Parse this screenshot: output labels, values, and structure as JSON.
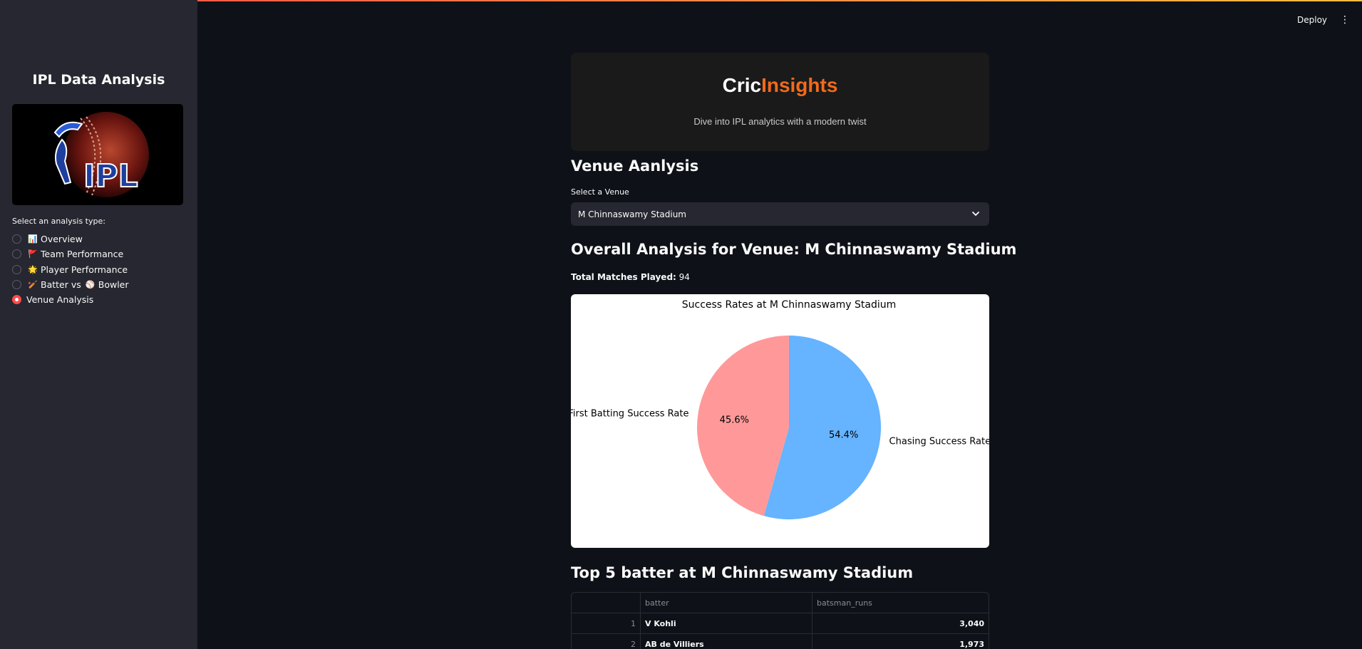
{
  "sidebar": {
    "title": "IPL Data Analysis",
    "logo_text": "IPL",
    "radio_label": "Select an analysis type:",
    "options": [
      {
        "icon": "📊",
        "label": "Overview",
        "selected": false
      },
      {
        "icon": "🚩",
        "label": "Team Performance",
        "selected": false
      },
      {
        "icon": "🌟",
        "label": "Player Performance",
        "selected": false
      },
      {
        "icon": "🏏",
        "label": "Batter vs",
        "icon2": "⚾",
        "label2": "Bowler",
        "selected": false
      },
      {
        "icon": "",
        "label": "Venue Analysis",
        "selected": true
      }
    ]
  },
  "header": {
    "deploy_label": "Deploy",
    "menu_icon": "⋮"
  },
  "hero": {
    "title_a": "Cric",
    "title_b": "Insights",
    "subtitle": "Dive into IPL analytics with a modern twist"
  },
  "venue": {
    "heading": "Venue Aanlysis",
    "select_label": "Select a Venue",
    "selected_venue": "M Chinnaswamy Stadium",
    "overall_heading": "Overall Analysis for Venue: M Chinnaswamy Stadium",
    "matches_label": "Total Matches Played:",
    "matches_value": "94"
  },
  "chart_data": {
    "type": "pie",
    "title": "Success Rates at M Chinnaswamy Stadium",
    "labels": [
      "Chasing Success Rate",
      "First Batting Success Rate"
    ],
    "values": [
      54.4,
      45.6
    ],
    "value_labels": [
      "54.4%",
      "45.6%"
    ],
    "colors": [
      "#66b3ff",
      "#ff9999"
    ]
  },
  "table": {
    "heading": "Top 5 batter at M Chinnaswamy Stadium",
    "columns": [
      "",
      "batter",
      "batsman_runs"
    ],
    "rows": [
      [
        "1",
        "V Kohli",
        "3,040"
      ],
      [
        "2",
        "AB de Villiers",
        "1,973"
      ]
    ]
  }
}
